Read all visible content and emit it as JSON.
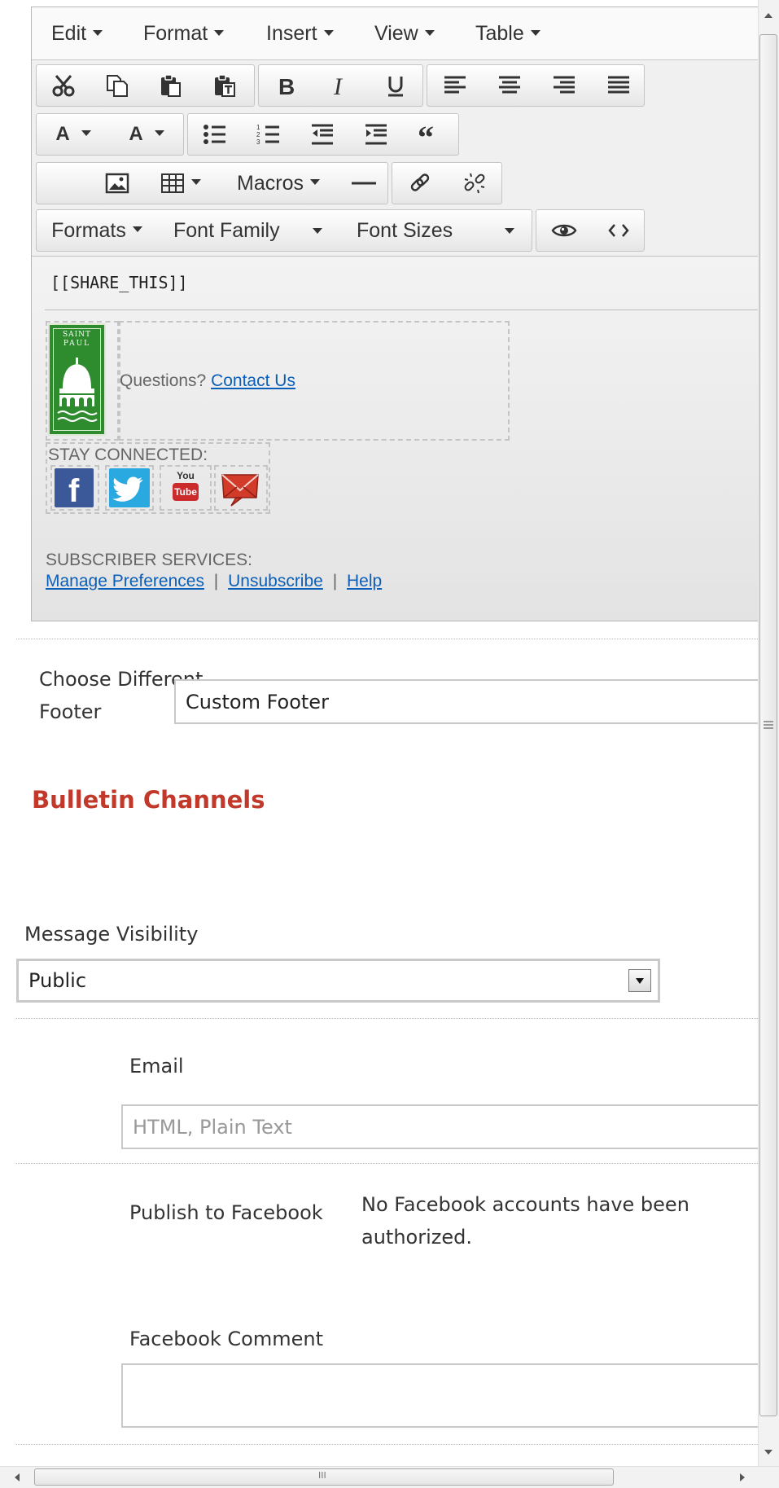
{
  "menubar": {
    "items": [
      "Edit",
      "Format",
      "Insert",
      "View",
      "Table"
    ]
  },
  "toolbar": {
    "row4": {
      "macros": "Macros",
      "formats": "Formats",
      "font_family": "Font Family",
      "font_sizes": "Font Sizes",
      "font_color_label": "A",
      "bg_color_label": "A"
    }
  },
  "content": {
    "share_this": "[[SHARE_THIS]]",
    "logo_text_line1": "SAINT",
    "logo_text_line2": "PAUL",
    "questions": "Questions?",
    "contact_us": "Contact Us",
    "stay_connected": "STAY CONNECTED:",
    "subscriber_services": "SUBSCRIBER SERVICES:",
    "manage_preferences": "Manage Preferences",
    "unsubscribe": "Unsubscribe",
    "help": "Help",
    "separator": "|",
    "youtube_you": "You",
    "youtube_tube": "Tube"
  },
  "footer_choice": {
    "label_line1": "Choose Different",
    "label_line2": "Footer",
    "value": "Custom Footer"
  },
  "bulletin_channels": {
    "title": "Bulletin Channels"
  },
  "message_visibility": {
    "label": "Message Visibility",
    "value": "Public"
  },
  "email": {
    "label": "Email",
    "placeholder": "HTML, Plain Text"
  },
  "facebook": {
    "publish_label": "Publish to Facebook",
    "status_line1": "No Facebook accounts have been",
    "status_line2": "authorized.",
    "comment_label": "Facebook Comment",
    "comment_value": ""
  },
  "scrollbar": {
    "h_grip": "III"
  },
  "colors": {
    "accent_red": "#c0392b",
    "link_blue": "#0b5fb8",
    "logo_green": "#2e8b2e"
  }
}
